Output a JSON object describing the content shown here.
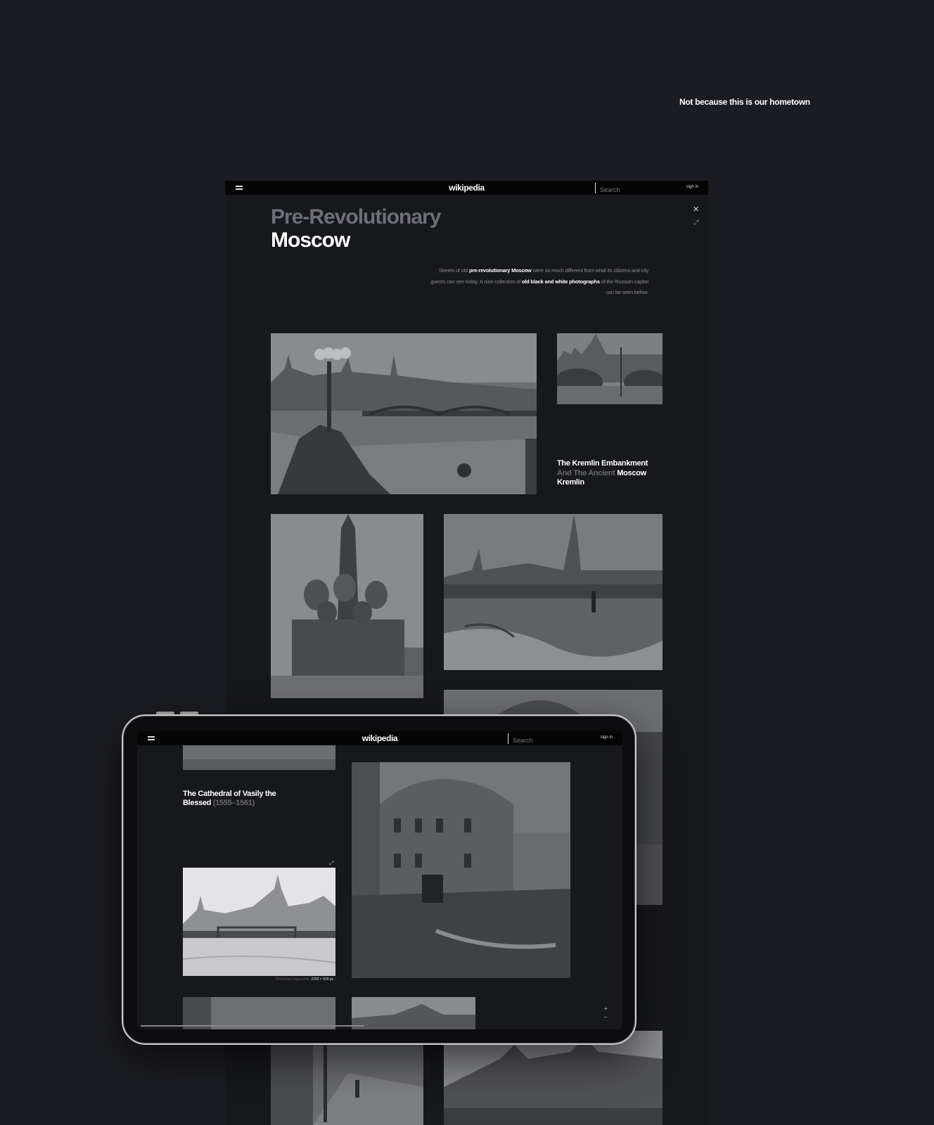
{
  "tagline": "Not because this is our hometown",
  "nav": {
    "logo": "wikipedia",
    "search_placeholder": "Search",
    "signin": "sign in"
  },
  "hero": {
    "title_line1": "Pre-Revolutionary",
    "title_line2": "Moscow",
    "desc": [
      {
        "t": "Streets of old ",
        "b": false
      },
      {
        "t": "pre-revolutionary Moscow",
        "b": true
      },
      {
        "t": " were so much different from what its citizens and city guests can see today. A nice collection of ",
        "b": false
      },
      {
        "t": "old black and white photographs",
        "b": true
      },
      {
        "t": " of the Russian capital can be seen below.",
        "b": false
      }
    ]
  },
  "caption_kremlin": {
    "part1": "The Kremlin Embankment",
    "part2": "And The Ancient",
    "part3": "Moscow Kremlin"
  },
  "caption_cathedral": {
    "part1": "The Cathedral of Vasily the Blessed",
    "part2": "(1555–1561)"
  },
  "download": {
    "label": "Download original file",
    "size": "2259 × 926 px"
  },
  "icons": {
    "close": "close-icon",
    "expand": "expand-icon",
    "menu": "menu-icon"
  },
  "colors": {
    "background": "#1b1c21",
    "page": "#17181c",
    "nav": "#050506",
    "muted_title": "#6e6e76"
  }
}
